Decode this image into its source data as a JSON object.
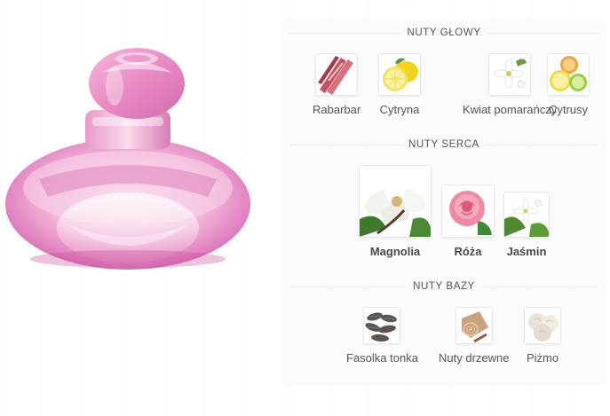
{
  "sections": [
    {
      "title": "NUTY GŁOWY",
      "notes": [
        {
          "label": "Rabarbar",
          "icon": "rhubarb-icon"
        },
        {
          "label": "Cytryna",
          "icon": "lemon-icon"
        },
        {
          "label": "Kwiat pomarańczy",
          "icon": "orange-blossom-icon"
        },
        {
          "label": "Cytrusy",
          "icon": "citrus-icon"
        }
      ]
    },
    {
      "title": "NUTY SERCA",
      "notes": [
        {
          "label": "Magnolia",
          "icon": "magnolia-icon"
        },
        {
          "label": "Róża",
          "icon": "rose-icon"
        },
        {
          "label": "Jaśmin",
          "icon": "jasmine-icon"
        }
      ]
    },
    {
      "title": "NUTY BAZY",
      "notes": [
        {
          "label": "Fasolka tonka",
          "icon": "tonka-bean-icon"
        },
        {
          "label": "Nuty drzewne",
          "icon": "wood-icon"
        },
        {
          "label": "Piżmo",
          "icon": "musk-icon"
        }
      ]
    }
  ],
  "colors": {
    "perfume_pink": "#e48ac4",
    "section_title": "#555555",
    "label": "#555555"
  }
}
